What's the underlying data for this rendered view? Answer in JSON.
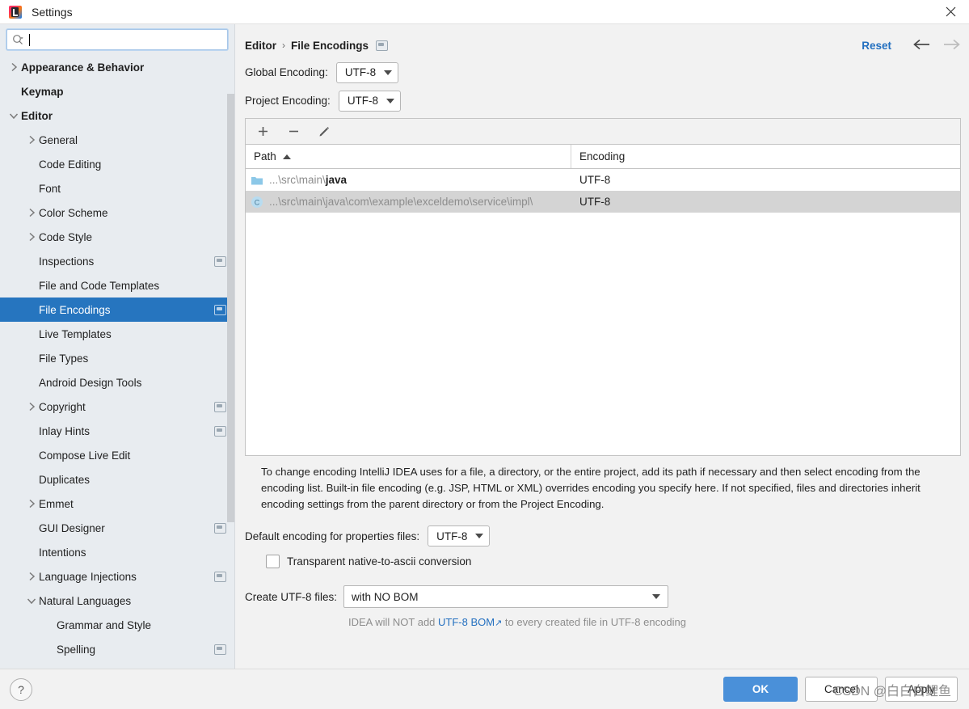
{
  "window": {
    "title": "Settings",
    "app_icon": "intellij-idea-icon",
    "close_icon": "close-icon"
  },
  "sidebar": {
    "search": {
      "placeholder": "",
      "value": "",
      "icon": "search-icon"
    },
    "items": [
      {
        "label": "Appearance & Behavior",
        "level": 0,
        "arrow": "chevron-right",
        "badge": false,
        "selected": false
      },
      {
        "label": "Keymap",
        "level": 0,
        "arrow": "none",
        "badge": false,
        "selected": false
      },
      {
        "label": "Editor",
        "level": 0,
        "arrow": "chevron-down",
        "badge": false,
        "selected": false
      },
      {
        "label": "General",
        "level": 1,
        "arrow": "chevron-right",
        "badge": false,
        "selected": false
      },
      {
        "label": "Code Editing",
        "level": 1,
        "arrow": "none",
        "badge": false,
        "selected": false
      },
      {
        "label": "Font",
        "level": 1,
        "arrow": "none",
        "badge": false,
        "selected": false
      },
      {
        "label": "Color Scheme",
        "level": 1,
        "arrow": "chevron-right",
        "badge": false,
        "selected": false
      },
      {
        "label": "Code Style",
        "level": 1,
        "arrow": "chevron-right",
        "badge": false,
        "selected": false
      },
      {
        "label": "Inspections",
        "level": 1,
        "arrow": "none",
        "badge": true,
        "selected": false
      },
      {
        "label": "File and Code Templates",
        "level": 1,
        "arrow": "none",
        "badge": false,
        "selected": false
      },
      {
        "label": "File Encodings",
        "level": 1,
        "arrow": "none",
        "badge": true,
        "selected": true
      },
      {
        "label": "Live Templates",
        "level": 1,
        "arrow": "none",
        "badge": false,
        "selected": false
      },
      {
        "label": "File Types",
        "level": 1,
        "arrow": "none",
        "badge": false,
        "selected": false
      },
      {
        "label": "Android Design Tools",
        "level": 1,
        "arrow": "none",
        "badge": false,
        "selected": false
      },
      {
        "label": "Copyright",
        "level": 1,
        "arrow": "chevron-right",
        "badge": true,
        "selected": false
      },
      {
        "label": "Inlay Hints",
        "level": 1,
        "arrow": "none",
        "badge": true,
        "selected": false
      },
      {
        "label": "Compose Live Edit",
        "level": 1,
        "arrow": "none",
        "badge": false,
        "selected": false
      },
      {
        "label": "Duplicates",
        "level": 1,
        "arrow": "none",
        "badge": false,
        "selected": false
      },
      {
        "label": "Emmet",
        "level": 1,
        "arrow": "chevron-right",
        "badge": false,
        "selected": false
      },
      {
        "label": "GUI Designer",
        "level": 1,
        "arrow": "none",
        "badge": true,
        "selected": false
      },
      {
        "label": "Intentions",
        "level": 1,
        "arrow": "none",
        "badge": false,
        "selected": false
      },
      {
        "label": "Language Injections",
        "level": 1,
        "arrow": "chevron-right",
        "badge": true,
        "selected": false
      },
      {
        "label": "Natural Languages",
        "level": 1,
        "arrow": "chevron-down",
        "badge": false,
        "selected": false
      },
      {
        "label": "Grammar and Style",
        "level": 2,
        "arrow": "none",
        "badge": false,
        "selected": false
      },
      {
        "label": "Spelling",
        "level": 2,
        "arrow": "none",
        "badge": true,
        "selected": false
      }
    ]
  },
  "content": {
    "breadcrumb": {
      "parent": "Editor",
      "separator": "›",
      "current": "File Encodings",
      "badge_icon": "project-scope-icon"
    },
    "reset_label": "Reset",
    "nav_back_icon": "arrow-left-icon",
    "nav_forward_icon": "arrow-right-icon",
    "global_encoding": {
      "label": "Global Encoding:",
      "value": "UTF-8"
    },
    "project_encoding": {
      "label": "Project Encoding:",
      "value": "UTF-8"
    },
    "toolbar": {
      "add_icon": "plus-icon",
      "remove_icon": "minus-icon",
      "edit_icon": "pencil-icon"
    },
    "table": {
      "columns": [
        "Path",
        "Encoding"
      ],
      "sort_column": "Path",
      "sort_direction": "asc",
      "rows": [
        {
          "icon": "folder-icon",
          "path_dim": "...\\src\\main\\",
          "path_strong": "java",
          "encoding": "UTF-8",
          "selected": false
        },
        {
          "icon": "class-file-icon",
          "path_dim": "...\\src\\main\\java\\com\\example\\exceldemo\\service\\impl\\",
          "path_strong": "",
          "encoding": "UTF-8",
          "selected": true
        }
      ]
    },
    "description": "To change encoding IntelliJ IDEA uses for a file, a directory, or the entire project, add its path if necessary and then select encoding from the encoding list. Built-in file encoding (e.g. JSP, HTML or XML) overrides encoding you specify here. If not specified, files and directories inherit encoding settings from the parent directory or from the Project Encoding.",
    "properties_encoding": {
      "label": "Default encoding for properties files:",
      "value": "UTF-8"
    },
    "transparent_conversion": {
      "label": "Transparent native-to-ascii conversion",
      "checked": false
    },
    "create_utf8": {
      "label": "Create UTF-8 files:",
      "value": "with NO BOM"
    },
    "hint": {
      "before": "IDEA will NOT add ",
      "link": "UTF-8 BOM",
      "link_arrow": "↗",
      "after": " to every created file in UTF-8 encoding"
    }
  },
  "footer": {
    "help_icon": "help-icon",
    "help_label": "?",
    "ok_label": "OK",
    "cancel_label": "Cancel",
    "apply_label": "Apply",
    "watermark": "CSDN @白白白鲤鱼"
  },
  "colors": {
    "accent": "#2675bf",
    "primary_button": "#4a90d9",
    "link": "#2470c0",
    "sidebar_bg": "#e8ecf0",
    "content_bg": "#f2f2f2"
  }
}
